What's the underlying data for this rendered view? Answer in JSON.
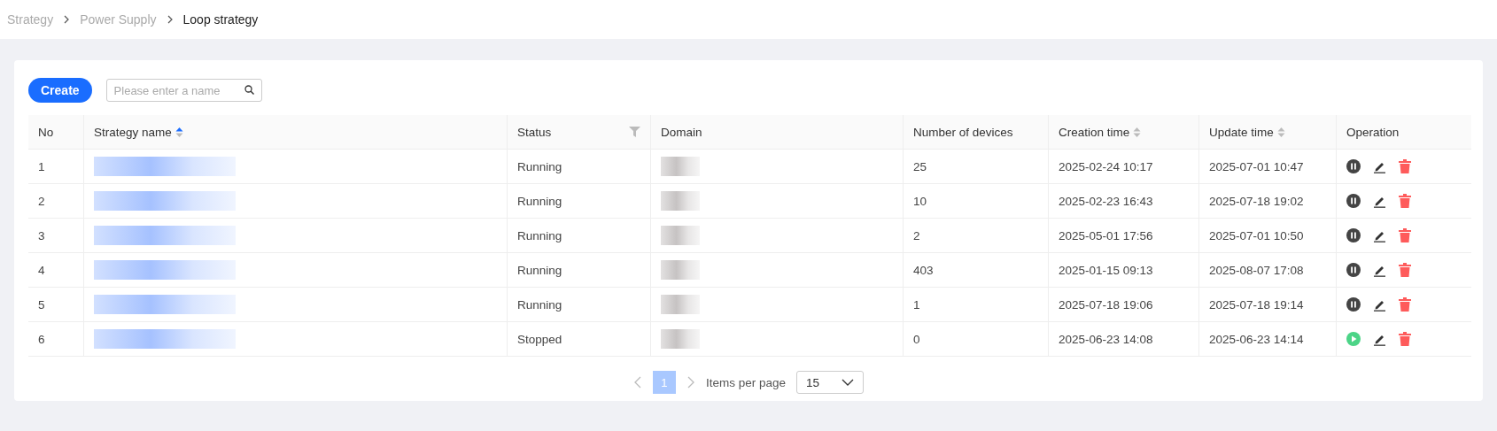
{
  "breadcrumb": [
    {
      "label": "Strategy",
      "current": false
    },
    {
      "label": "Power Supply",
      "current": false
    },
    {
      "label": "Loop strategy",
      "current": true
    }
  ],
  "toolbar": {
    "create_button": "Create",
    "search": {
      "placeholder": "Please enter a name"
    }
  },
  "table": {
    "columns": [
      {
        "label": "No",
        "sortable": false,
        "filter": false
      },
      {
        "label": "Strategy name",
        "sortable": true,
        "sorted_asc": true,
        "filter": false
      },
      {
        "label": "Status",
        "sortable": false,
        "filter": true
      },
      {
        "label": "Domain",
        "sortable": false,
        "filter": false
      },
      {
        "label": "Number of devices",
        "sortable": false,
        "filter": false
      },
      {
        "label": "Creation time",
        "sortable": true,
        "sorted_asc": false,
        "filter": false
      },
      {
        "label": "Update time",
        "sortable": true,
        "sorted_asc": false,
        "filter": false
      },
      {
        "label": "Operation",
        "sortable": false,
        "filter": false
      }
    ],
    "rows": [
      {
        "no": "1",
        "name_redacted": true,
        "status": "Running",
        "domain_redacted": true,
        "devices": "25",
        "created": "2025-02-24 10:17",
        "updated": "2025-07-01 10:47",
        "running": true
      },
      {
        "no": "2",
        "name_redacted": true,
        "status": "Running",
        "domain_redacted": true,
        "devices": "10",
        "created": "2025-02-23 16:43",
        "updated": "2025-07-18 19:02",
        "running": true
      },
      {
        "no": "3",
        "name_redacted": true,
        "status": "Running",
        "domain_redacted": true,
        "devices": "2",
        "created": "2025-05-01 17:56",
        "updated": "2025-07-01 10:50",
        "running": true
      },
      {
        "no": "4",
        "name_redacted": true,
        "status": "Running",
        "domain_redacted": true,
        "devices": "403",
        "created": "2025-01-15 09:13",
        "updated": "2025-08-07 17:08",
        "running": true
      },
      {
        "no": "5",
        "name_redacted": true,
        "status": "Running",
        "domain_redacted": true,
        "devices": "1",
        "created": "2025-07-18 19:06",
        "updated": "2025-07-18 19:14",
        "running": true
      },
      {
        "no": "6",
        "name_redacted": true,
        "status": "Stopped",
        "domain_redacted": true,
        "devices": "0",
        "created": "2025-06-23 14:08",
        "updated": "2025-06-23 14:14",
        "running": false
      }
    ]
  },
  "pagination": {
    "pages": [
      {
        "label": "1",
        "selected": true
      }
    ],
    "items_per_page_label": "Items per page",
    "page_size": "15"
  }
}
